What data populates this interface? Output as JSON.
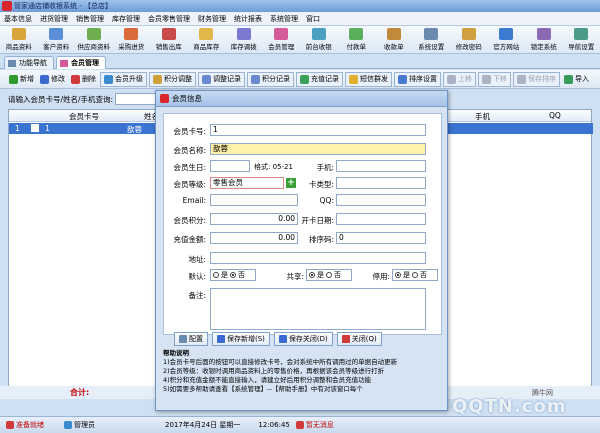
{
  "window": {
    "title": "管家通店铺收银系统 - 【总店】"
  },
  "menu": [
    "基本信息",
    "进货管理",
    "销售管理",
    "库存管理",
    "会员零售管理",
    "财务管理",
    "统计报表",
    "系统管理",
    "窗口"
  ],
  "iconbar": [
    {
      "label": "商品资料",
      "icon": "goods-icon",
      "color": "#d9a43a"
    },
    {
      "label": "客户资料",
      "icon": "customer-icon",
      "color": "#5a8fd8"
    },
    {
      "label": "供应商资料",
      "icon": "supplier-icon",
      "color": "#6fae4e"
    },
    {
      "label": "采购进货",
      "icon": "purchase-icon",
      "color": "#d86a3a"
    },
    {
      "label": "销售出库",
      "icon": "sales-icon",
      "color": "#c94a4a"
    },
    {
      "label": "商品库存",
      "icon": "stock-icon",
      "color": "#e0b84a"
    },
    {
      "label": "库存调拨",
      "icon": "transfer-icon",
      "color": "#7a7ad0"
    },
    {
      "label": "会员管理",
      "icon": "member-icon",
      "color": "#d45a9a"
    },
    {
      "label": "前台收银",
      "icon": "cashier-icon",
      "color": "#4aa0c0"
    },
    {
      "label": "付款单",
      "icon": "payment-icon",
      "color": "#5ab05a"
    },
    {
      "label": "收款单",
      "icon": "receipt-icon",
      "color": "#c08a3a"
    },
    {
      "label": "系统设置",
      "icon": "settings-icon",
      "color": "#6a8ab0"
    },
    {
      "label": "修改密码",
      "icon": "password-icon",
      "color": "#d0a040"
    },
    {
      "label": "官方网站",
      "icon": "website-icon",
      "color": "#3a7ad0"
    },
    {
      "label": "锁定系统",
      "icon": "lock-icon",
      "color": "#8a6ab0"
    },
    {
      "label": "导航设置",
      "icon": "nav-icon",
      "color": "#4a9a8a"
    }
  ],
  "tabs": [
    {
      "label": "功能导航",
      "active": false
    },
    {
      "label": "会员管理",
      "active": true
    }
  ],
  "toolbar": [
    {
      "label": "新增",
      "icon": "add-icon",
      "color": "#2e9a2e",
      "state": "normal"
    },
    {
      "label": "修改",
      "icon": "edit-icon",
      "color": "#3a6ad0",
      "state": "normal"
    },
    {
      "label": "删除",
      "icon": "delete-icon",
      "color": "#d03a3a",
      "state": "normal"
    },
    {
      "label": "会员升级",
      "icon": "upgrade-icon",
      "color": "#3a8ad0",
      "state": "framed"
    },
    {
      "label": "积分调整",
      "icon": "points-icon",
      "color": "#d0a03a",
      "state": "framed"
    },
    {
      "label": "调整记录",
      "icon": "record-icon",
      "color": "#6a8ad0",
      "state": "framed"
    },
    {
      "label": "积分记录",
      "icon": "points-record-icon",
      "color": "#6a8ad0",
      "state": "framed"
    },
    {
      "label": "充值记录",
      "icon": "recharge-icon",
      "color": "#3aa05a",
      "state": "framed"
    },
    {
      "label": "短信群发",
      "icon": "sms-icon",
      "color": "#e0b030",
      "state": "framed"
    },
    {
      "label": "排序设置",
      "icon": "sort-icon",
      "color": "#4a7ad0",
      "state": "framed"
    },
    {
      "label": "上移",
      "icon": "up-icon",
      "color": "#aab4c4",
      "state": "disabled"
    },
    {
      "label": "下移",
      "icon": "down-icon",
      "color": "#aab4c4",
      "state": "disabled"
    },
    {
      "label": "保存排序",
      "icon": "save-sort-icon",
      "color": "#aab4c4",
      "state": "disabled"
    },
    {
      "label": "导入",
      "icon": "import-icon",
      "color": "#3a9a5a",
      "state": "normal"
    }
  ],
  "search": {
    "label": "请输入会员卡号/姓名/手机查询:"
  },
  "grid": {
    "headers": [
      "会员卡号",
      "姓名",
      "手机",
      "QQ"
    ],
    "rows": [
      {
        "no": "1",
        "card": "1",
        "name": "歆蓉"
      }
    ]
  },
  "summary": {
    "label": "合计:"
  },
  "dialog": {
    "title": "会员信息",
    "fields": {
      "card_label": "会员卡号:",
      "card": "1",
      "name_label": "会员名称:",
      "name": "歆蓉",
      "birthday_label": "会员生日:",
      "birthday": "",
      "format_label": "格式: 05-21",
      "mobile_label": "手机:",
      "mobile": "",
      "level_label": "会员等级:",
      "level": "零售会员",
      "idcard_label": "卡类型:",
      "idcard": "",
      "email_label": "Email:",
      "email": "",
      "qq_label": "QQ:",
      "qq": "",
      "points_label": "会员积分:",
      "points": "0.00",
      "opendate_label": "开卡日期:",
      "opendate": "",
      "recharge_label": "充值金额:",
      "recharge": "0.00",
      "sort_label": "排序码:",
      "sort": "0",
      "address_label": "地址:",
      "address": "",
      "default_label": "默认:",
      "share_label": "共享:",
      "disable_label": "停用:",
      "yes": "是",
      "no": "否",
      "remark_label": "备注:",
      "remark": ""
    },
    "radios": {
      "default": "no",
      "share": "yes",
      "disable": "yes"
    },
    "buttons": [
      {
        "label": "配置",
        "icon": "config-icon",
        "color": "#6a8ab0"
      },
      {
        "label": "保存新增(S)",
        "icon": "save-add-icon",
        "color": "#3a6ad0"
      },
      {
        "label": "保存关闭(D)",
        "icon": "save-close-icon",
        "color": "#3a6ad0"
      },
      {
        "label": "关闭(Q)",
        "icon": "close-icon",
        "color": "#d03a3a"
      }
    ],
    "help": {
      "title": "帮助说明",
      "lines": [
        "1)会员卡号后面的按钮可以直接修改卡号，会对系统中所有调用过的单据自动更新",
        "2)会员等级：收银时调用商品资料上的零售价格，再根据该会员等级进行打折",
        "4)积分和充值金额不能直接输入，请建立好后用积分调整和会员充值功能",
        "5)如需要多帮助请查看【系统管理】--【帮助手册】中有对该窗口每个"
      ]
    }
  },
  "status": [
    {
      "label": "准备就绪",
      "icon": "ready-icon",
      "color": "#d03a3a",
      "text_color": "#c00000"
    },
    {
      "label": "管理员",
      "icon": "user-icon",
      "color": "#3a8ad0",
      "text_color": "#000000"
    },
    {
      "label": "2017年4月24日  星期一",
      "icon": "",
      "color": "",
      "text_color": "#000000"
    },
    {
      "label": "12:06:45",
      "icon": "",
      "color": "",
      "text_color": "#000000"
    },
    {
      "label": "暂无消息",
      "icon": "message-icon",
      "color": "#d03a3a",
      "text_color": "#c00000"
    }
  ],
  "watermark": {
    "brand": "QQTN.com",
    "site": "腾牛网"
  }
}
